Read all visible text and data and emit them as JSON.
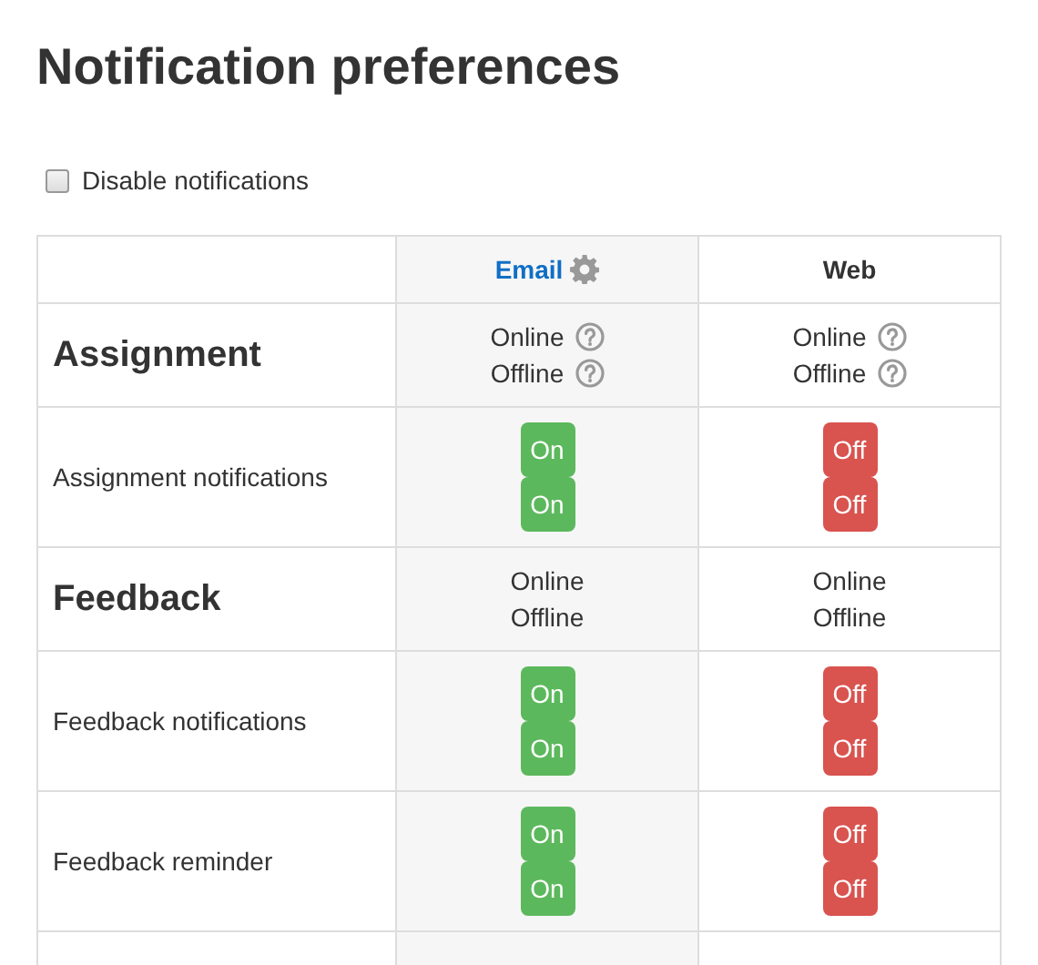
{
  "title": "Notification preferences",
  "disable_notifications": {
    "label": "Disable notifications",
    "checked": false
  },
  "columns": [
    {
      "label": "Email",
      "kind": "link"
    },
    {
      "label": "Web",
      "kind": "plain"
    }
  ],
  "rows": [
    {
      "kind": "component",
      "name": "Assignment",
      "cells": [
        {
          "lines": [
            {
              "label": "Online",
              "help": true
            },
            {
              "label": "Offline",
              "help": true
            }
          ]
        },
        {
          "lines": [
            {
              "label": "Online",
              "help": true
            },
            {
              "label": "Offline",
              "help": true
            }
          ]
        }
      ]
    },
    {
      "kind": "notification",
      "name": "Assignment notifications",
      "cells": [
        {
          "toggles": [
            {
              "label": "On",
              "on": true
            },
            {
              "label": "On",
              "on": true
            }
          ]
        },
        {
          "toggles": [
            {
              "label": "Off",
              "on": false
            },
            {
              "label": "Off",
              "on": false
            }
          ]
        }
      ]
    },
    {
      "kind": "component",
      "name": "Feedback",
      "cells": [
        {
          "lines": [
            {
              "label": "Online",
              "help": false
            },
            {
              "label": "Offline",
              "help": false
            }
          ]
        },
        {
          "lines": [
            {
              "label": "Online",
              "help": false
            },
            {
              "label": "Offline",
              "help": false
            }
          ]
        }
      ]
    },
    {
      "kind": "notification",
      "name": "Feedback notifications",
      "cells": [
        {
          "toggles": [
            {
              "label": "On",
              "on": true
            },
            {
              "label": "On",
              "on": true
            }
          ]
        },
        {
          "toggles": [
            {
              "label": "Off",
              "on": false
            },
            {
              "label": "Off",
              "on": false
            }
          ]
        }
      ]
    },
    {
      "kind": "notification",
      "name": "Feedback reminder",
      "cells": [
        {
          "toggles": [
            {
              "label": "On",
              "on": true
            },
            {
              "label": "On",
              "on": true
            }
          ]
        },
        {
          "toggles": [
            {
              "label": "Off",
              "on": false
            },
            {
              "label": "Off",
              "on": false
            }
          ]
        }
      ]
    }
  ]
}
